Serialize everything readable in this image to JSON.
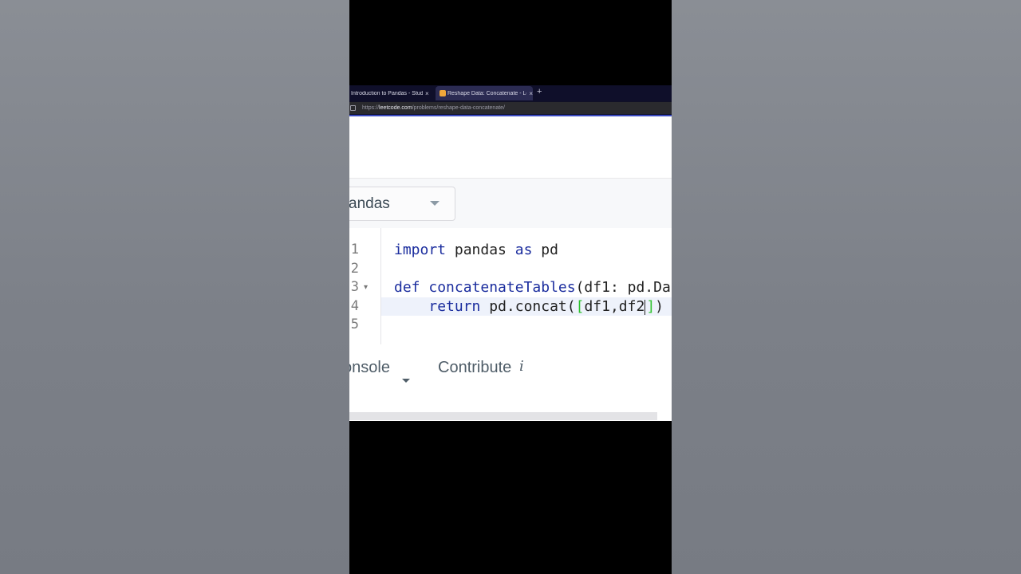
{
  "browser": {
    "tabs": [
      {
        "label": "Introduction to Pandas - Study Pl",
        "active": false
      },
      {
        "label": "Reshape Data: Concatenate - Lee",
        "active": true
      }
    ],
    "close_glyph": "×",
    "new_tab_glyph": "+",
    "url_prefix": "https://",
    "url_host": "leetcode.com",
    "url_path": "/problems/reshape-data-concatenate/"
  },
  "toolbar": {
    "language": "andas"
  },
  "editor": {
    "line_numbers": [
      "1",
      "2",
      "3",
      "4",
      "5"
    ],
    "fold_marker": "▾",
    "lines": {
      "l1_kw1": "import",
      "l1_rest": " pandas ",
      "l1_kw2": "as",
      "l1_end": " pd",
      "l3_kw": "def",
      "l3_fn": " concatenateTables",
      "l3_rest": "(df1: pd.Da",
      "l4_indent": "    ",
      "l4_kw": "return",
      "l4_rest": " pd.concat(",
      "l4_br_open": "[",
      "l4_args": "df1,df2",
      "l4_br_close": "]",
      "l4_end": ")"
    }
  },
  "bottom": {
    "console_label": "onsole",
    "contribute_label": "Contribute",
    "info_glyph": "i"
  },
  "colors": {
    "keyword": "#1b2d9e",
    "bracket_match": "#2ec22e",
    "accent_line": "#3a4ac0"
  }
}
